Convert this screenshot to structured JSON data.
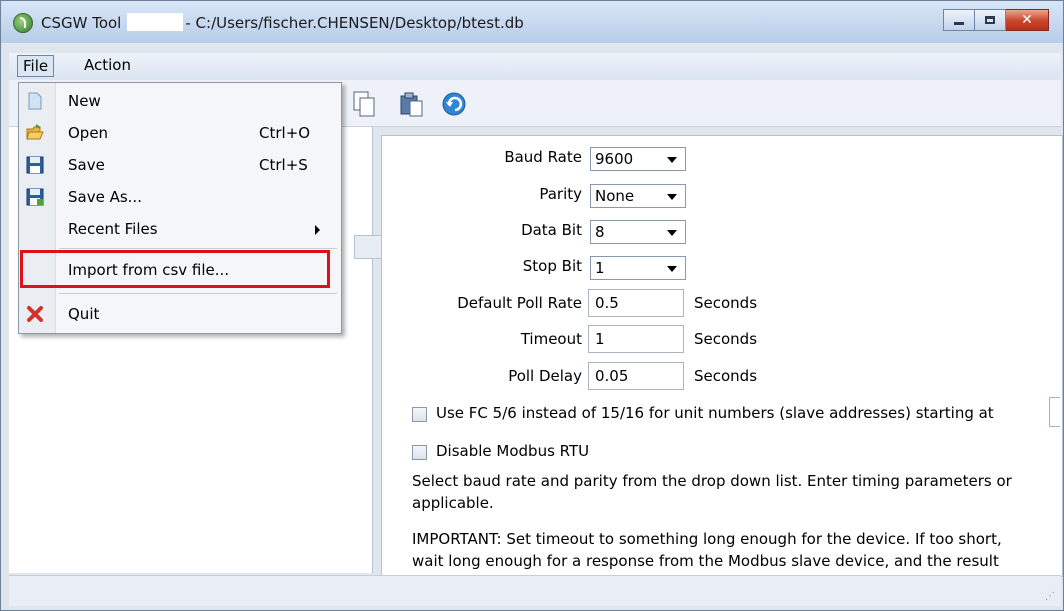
{
  "window": {
    "title_app": "CSGW Tool",
    "title_path": "- C:/Users/fischer.CHENSEN/Desktop/btest.db"
  },
  "menubar": {
    "file": "File",
    "action": "Action"
  },
  "file_menu": {
    "new": "New",
    "open": "Open",
    "open_shortcut": "Ctrl+O",
    "save": "Save",
    "save_shortcut": "Ctrl+S",
    "save_as": "Save As...",
    "recent_files": "Recent Files",
    "import_csv": "Import from csv file...",
    "quit": "Quit"
  },
  "form": {
    "baud_rate_label": "Baud Rate",
    "baud_rate_value": "9600",
    "parity_label": "Parity",
    "parity_value": "None",
    "data_bit_label": "Data Bit",
    "data_bit_value": "8",
    "stop_bit_label": "Stop Bit",
    "stop_bit_value": "1",
    "poll_rate_label": "Default Poll Rate",
    "poll_rate_value": "0.5",
    "poll_rate_unit": "Seconds",
    "timeout_label": "Timeout",
    "timeout_value": "1",
    "timeout_unit": "Seconds",
    "poll_delay_label": "Poll Delay",
    "poll_delay_value": "0.05",
    "poll_delay_unit": "Seconds",
    "fc56_label": "Use FC 5/6 instead of 15/16 for unit numbers (slave addresses) starting at",
    "disable_rtu_label": "Disable Modbus RTU",
    "help_line1": "Select baud rate and parity from the drop down list. Enter timing parameters or",
    "help_line2": "applicable.",
    "help_line3": "IMPORTANT: Set timeout to something long enough for the device. If too short,",
    "help_line4": "wait long enough for a response from the Modbus slave device, and the result"
  },
  "colors": {
    "highlight_box": "#e0101a",
    "title_gradient_top": "#d8e6f7"
  }
}
